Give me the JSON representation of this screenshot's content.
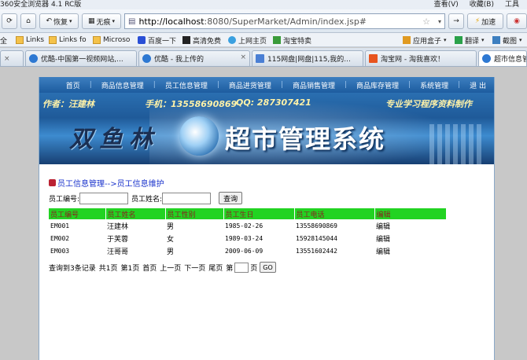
{
  "browser": {
    "title": "360安全浏览器 4.1 RC版",
    "menu": [
      "查看(V)",
      "收藏(B)",
      "工具"
    ],
    "nav": {
      "back_icon": "back-icon",
      "home_icon": "home-icon",
      "restore_label": "恢复",
      "noad_label": "无痕",
      "address": "http://localhost:8080/SuperMarket/Admin/index.jsp#",
      "address_host": "http://localhost",
      "address_rest": ":8080/SuperMarket/Admin/index.jsp#",
      "accel_label": "加速"
    },
    "bookmarks": [
      {
        "label": "全",
        "icon": "folder-icon"
      },
      {
        "label": "Links",
        "icon": "folder-icon"
      },
      {
        "label": "Links fo",
        "icon": "folder-icon"
      },
      {
        "label": "Microso",
        "icon": "folder-icon"
      },
      {
        "label": "百度一下",
        "icon": "baidu-icon"
      },
      {
        "label": "高清免费",
        "icon": "movie-icon"
      },
      {
        "label": "上网主页",
        "icon": "home-page-icon"
      },
      {
        "label": "淘宝特卖",
        "icon": "taobao-icon"
      },
      {
        "label": "应用盒子",
        "icon": "app-box-icon"
      },
      {
        "label": "翻译",
        "icon": "translate-icon"
      },
      {
        "label": "截图",
        "icon": "screenshot-icon"
      }
    ],
    "tabs": [
      {
        "label": "优酷-中国第一视频网站,...",
        "color": "#2d78d2"
      },
      {
        "label": "优酷 - 我上传的",
        "color": "#2d78d2"
      },
      {
        "label": "115网盘|网盘|115,我的...",
        "color": "#4a7fd4"
      },
      {
        "label": "淘宝网 - 淘我喜欢！",
        "color": "#e8541e"
      },
      {
        "label": "超市信息管",
        "color": "#2d78d2"
      }
    ]
  },
  "app": {
    "menu": [
      "首页",
      "商品信息管理",
      "员工信息管理",
      "商品进货管理",
      "商品销售管理",
      "商品库存管理",
      "系统管理",
      "退 出"
    ],
    "banner": {
      "author": "作者：汪建林",
      "phone": "手机：13558690869",
      "qq": "QQ: 287307421",
      "tagline": "专业学习程序资料制作",
      "brand": "双鱼林",
      "system": "超市管理系统"
    },
    "breadcrumb": "员工信息管理-->员工信息维护",
    "search": {
      "id_label": "员工编号:",
      "name_label": "员工姓名:",
      "id_value": "",
      "name_value": "",
      "button": "查询"
    },
    "table": {
      "headers": [
        "员工编号",
        "员工姓名",
        "员工性别",
        "员工生日",
        "员工电话",
        "编辑"
      ],
      "rows": [
        {
          "id": "EM001",
          "name": "汪建林",
          "sex": "男",
          "birthday": "1985-02-26",
          "phone": "13558690869",
          "edit": "编辑"
        },
        {
          "id": "EM002",
          "name": "于芙蓉",
          "sex": "女",
          "birthday": "1989-03-24",
          "phone": "15928145044",
          "edit": "编辑"
        },
        {
          "id": "EM003",
          "name": "汪哥哥",
          "sex": "男",
          "birthday": "2009-06-09",
          "phone": "13551602442",
          "edit": "编辑"
        }
      ]
    },
    "pager": {
      "summary": "查询到3条记录",
      "total": "共1页",
      "current": "第1页",
      "first": "首页",
      "prev": "上一页",
      "next": "下一页",
      "last": "尾页",
      "goto_prefix": "第",
      "goto_suffix": "页",
      "goto_value": "",
      "go": "GO"
    }
  }
}
